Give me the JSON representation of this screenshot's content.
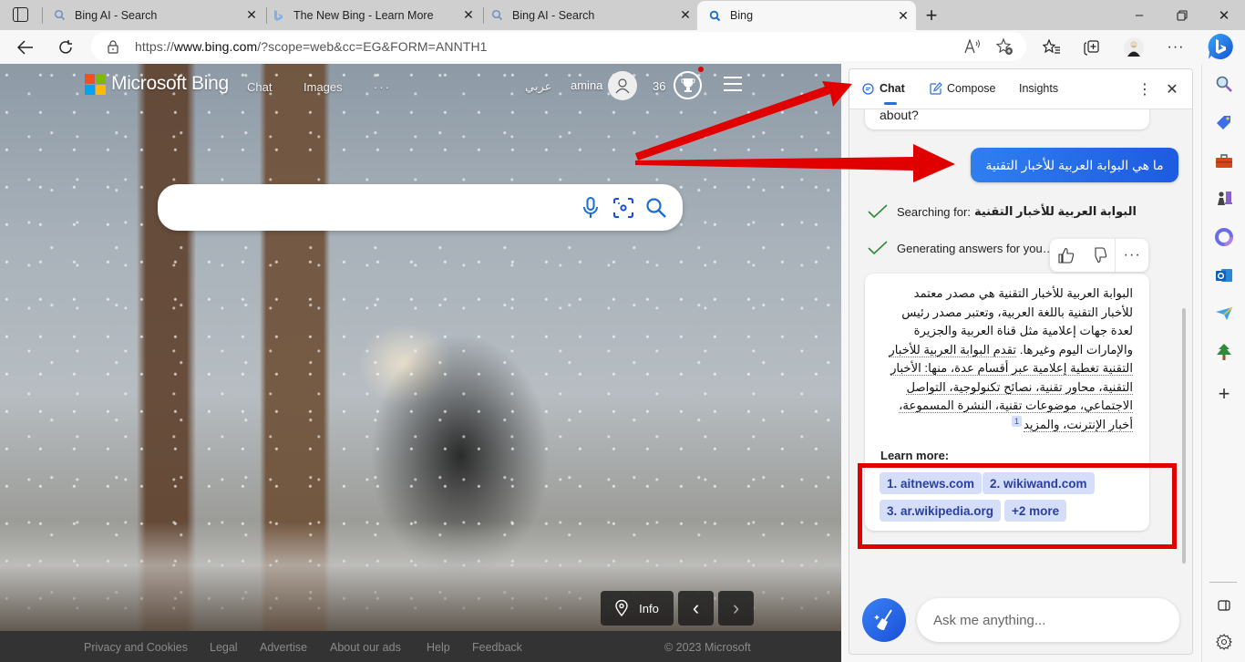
{
  "browser": {
    "tabs": [
      {
        "title": "Bing AI - Search",
        "icon": "search-icon"
      },
      {
        "title": "The New Bing - Learn More",
        "icon": "bing-logo-icon"
      },
      {
        "title": "Bing AI - Search",
        "icon": "search-icon"
      },
      {
        "title": "Bing",
        "icon": "search-icon",
        "active": true
      }
    ],
    "new_tab": "+",
    "window_controls": {
      "minimize": "–",
      "restore": "⧉",
      "close": "✕"
    },
    "address": {
      "prefix": "https://",
      "domain": "www.bing.com",
      "path": "/?scope=web&cc=EG&FORM=ANNTH1"
    },
    "toolbar_icons": [
      "read-aloud-icon",
      "add-favorite-icon",
      "favorites-icon",
      "collections-icon",
      "profile-avatar",
      "more-icon",
      "bing-copilot-icon"
    ]
  },
  "bing_page": {
    "brand": "Microsoft Bing",
    "nav": [
      "Chat",
      "Images",
      "···"
    ],
    "language": "عربي",
    "user_name": "amina",
    "rewards_count": "36",
    "search": {
      "value": "",
      "placeholder": ""
    },
    "image_controls": {
      "info_label": "Info",
      "prev": "‹",
      "next": "›"
    },
    "footer": {
      "links": [
        "Privacy and Cookies",
        "Legal",
        "Advertise",
        "About our ads",
        "Help",
        "Feedback"
      ],
      "copyright": "© 2023 Microsoft"
    }
  },
  "chat_panel": {
    "tabs": [
      {
        "label": "Chat",
        "active": true
      },
      {
        "label": "Compose"
      },
      {
        "label": "Insights"
      }
    ],
    "more_label": "⋮",
    "close_label": "✕",
    "previous_message_tail": "about?",
    "user_message": "ما هي البوابة العربية للأخبار التقنية",
    "status": [
      {
        "label": "Searching for:",
        "query": "البوابة العربية للأخبار التقنية"
      },
      {
        "label": "Generating answers for you…"
      }
    ],
    "answer": {
      "part1": "البوابة العربية للأخبار التقنية هي مصدر معتمد للأخبار التقنية باللغة العربية، وتعتبر مصدر رئيس لعدة جهات إعلامية مثل قناة العربية والجزيرة والإمارات اليوم وغيرها.",
      "part2": "تقدم البوابة العربية للأخبار التقنية تغطية إعلامية عبر أقسام عدة، منها: الأخبار التقنية، محاور تقنية، نصائح تكنولوجية، التواصل الاجتماعي، موضوعات تقنية، النشرة المسموعة، أخبار الإنترنت، والمزيد",
      "citation": "1"
    },
    "learn_more_label": "Learn more:",
    "sources": [
      "1. aitnews.com",
      "2. wikiwand.com",
      "3. ar.wikipedia.org",
      "+2 more"
    ],
    "input": {
      "value": "",
      "placeholder": "Ask me anything..."
    },
    "new_topic_icon": "broom-icon"
  },
  "edge_sidebar": {
    "icons": [
      "search-icon",
      "shopping-tag-icon",
      "tools-icon",
      "games-icon",
      "microsoft-365-icon",
      "outlook-icon",
      "drop-icon",
      "tree-icon",
      "add-icon"
    ],
    "bottom_icons": [
      "split-panel-icon",
      "settings-icon"
    ]
  },
  "annotations": {
    "highlight_color": "#e00000",
    "arrow_color": "#e00000"
  },
  "colors": {
    "accent": "#1d5be0",
    "source_chip_bg": "#d5def8",
    "source_chip_text": "#2b3fa3",
    "check": "#2e8b3a"
  }
}
